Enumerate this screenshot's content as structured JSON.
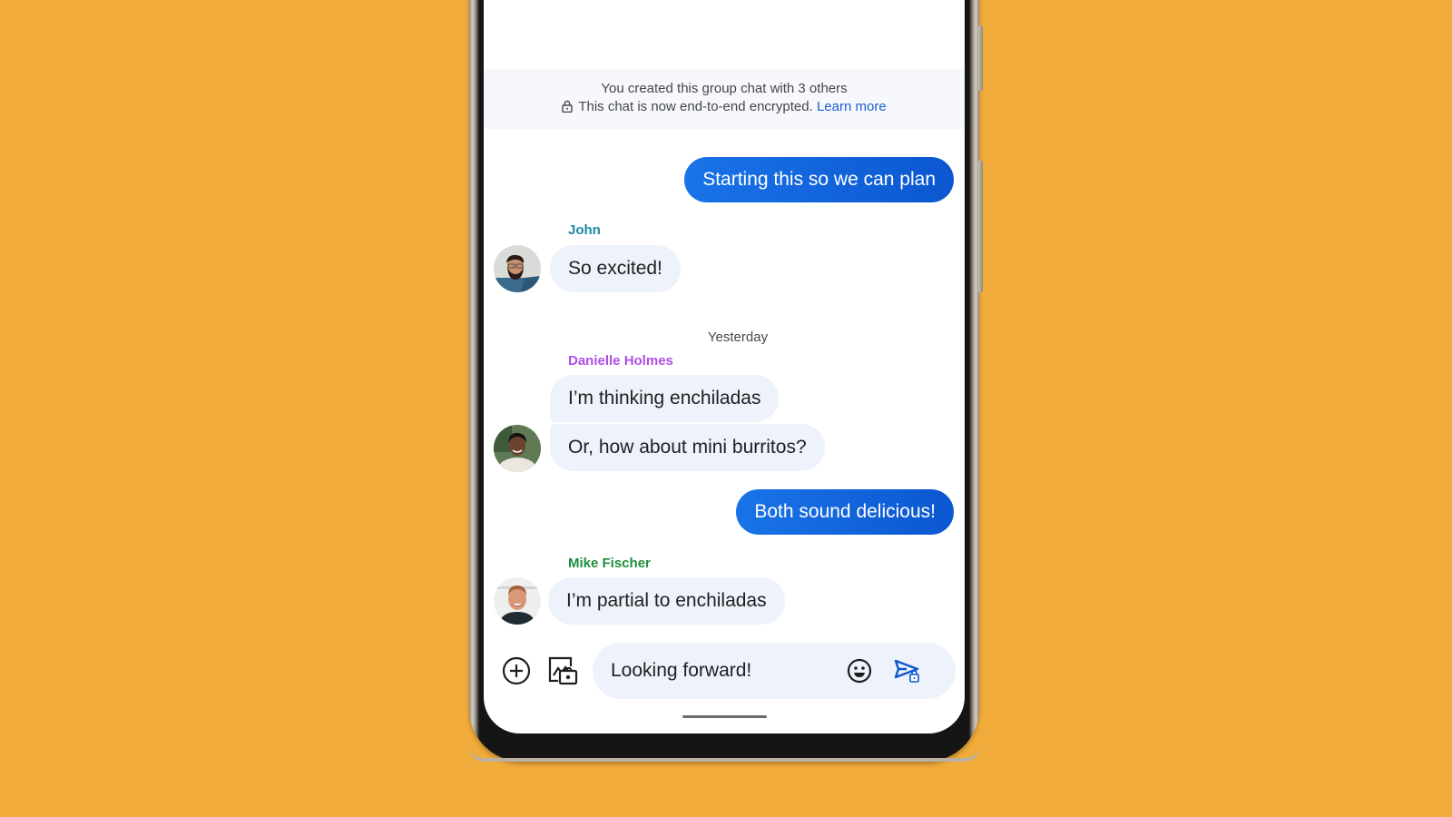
{
  "background_color": "#f0ab3a",
  "info_banner": {
    "line1": "You created this group chat with 3 others",
    "line2": "This chat is now end-to-end encrypted.",
    "learn_more": "Learn more",
    "lock_icon": "lock-icon"
  },
  "colors": {
    "sent_bubble_start": "#1a73e8",
    "sent_bubble_end": "#0b57d0",
    "received_bubble": "#edf2fb",
    "link": "#1a5fd0",
    "john": "#1a8a9e",
    "danielle": "#b04ee8",
    "mike": "#1e8e3e"
  },
  "messages": [
    {
      "type": "sent",
      "text": "Starting this so we can plan"
    },
    {
      "type": "received",
      "sender": "John",
      "text": "So excited!"
    },
    {
      "type": "divider",
      "text": "Yesterday"
    },
    {
      "type": "received",
      "sender": "Danielle Holmes",
      "text": "I’m thinking enchiladas"
    },
    {
      "type": "received",
      "sender": "Danielle Holmes",
      "text": "Or, how about mini burritos?"
    },
    {
      "type": "sent",
      "text": "Both sound delicious!"
    },
    {
      "type": "received",
      "sender": "Mike Fischer",
      "text": "I’m partial to enchiladas"
    }
  ],
  "compose": {
    "value": "Looking forward!",
    "icons": {
      "add": "add-circle-icon",
      "gallery": "gallery-camera-icon",
      "emoji": "emoji-icon",
      "send": "send-encrypted-icon"
    }
  }
}
